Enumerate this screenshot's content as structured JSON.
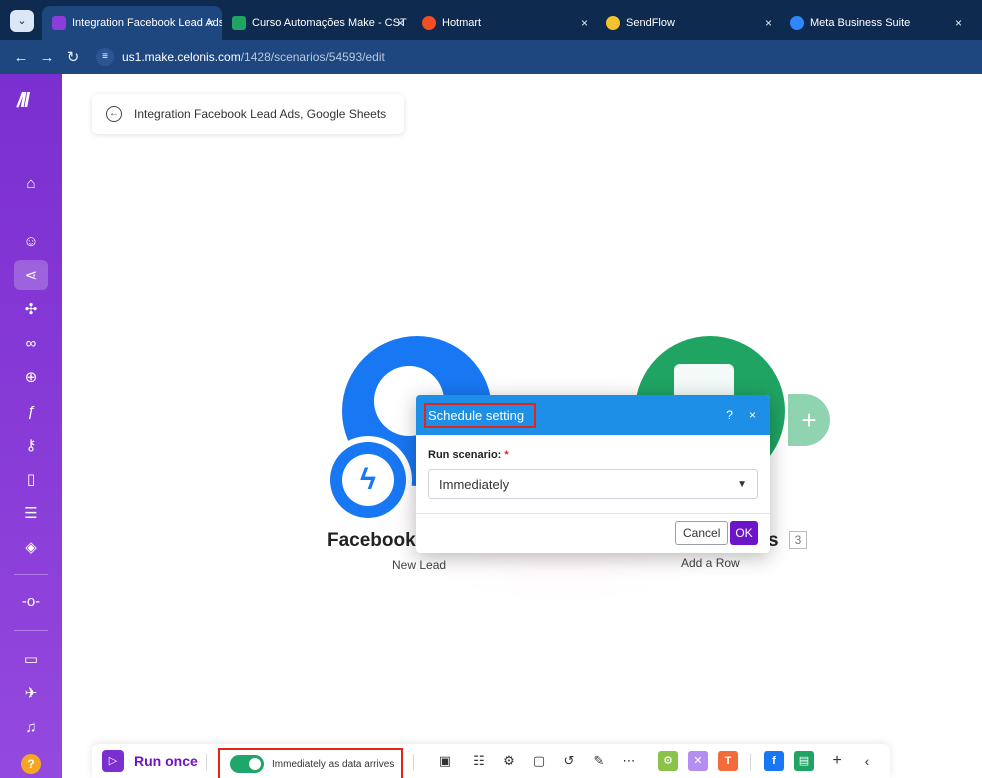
{
  "browser": {
    "tabs": [
      {
        "title": "Integration Facebook Lead Ads",
        "active": true
      },
      {
        "title": "Curso Automações Make - CST",
        "active": false
      },
      {
        "title": "Hotmart",
        "active": false
      },
      {
        "title": "SendFlow",
        "active": false
      },
      {
        "title": "Meta Business Suite",
        "active": false
      }
    ],
    "url_host": "us1.make.celonis.com",
    "url_path": "/1428/scenarios/54593/edit"
  },
  "scenario": {
    "title": "Integration Facebook Lead Ads, Google Sheets"
  },
  "modules": {
    "facebook": {
      "label": "Facebook",
      "sub": "New Lead"
    },
    "sheets": {
      "label": "s",
      "sub": "Add a Row",
      "count": "3"
    }
  },
  "dialog": {
    "title": "Schedule setting",
    "help": "?",
    "close": "×",
    "field_label": "Run scenario:",
    "required_mark": "*",
    "selected_value": "Immediately",
    "cancel_label": "Cancel",
    "ok_label": "OK"
  },
  "toolbar": {
    "run_label": "Run once",
    "schedule_label": "Immediately as data arrives",
    "schedule_on": true
  },
  "colors": {
    "sidebar": "#7b2fd0",
    "dialog_header": "#1e8fe6",
    "ok_button": "#6d14c8",
    "highlight": "#e0251b",
    "facebook_blue": "#1877f2",
    "sheets_green": "#1fa463"
  }
}
